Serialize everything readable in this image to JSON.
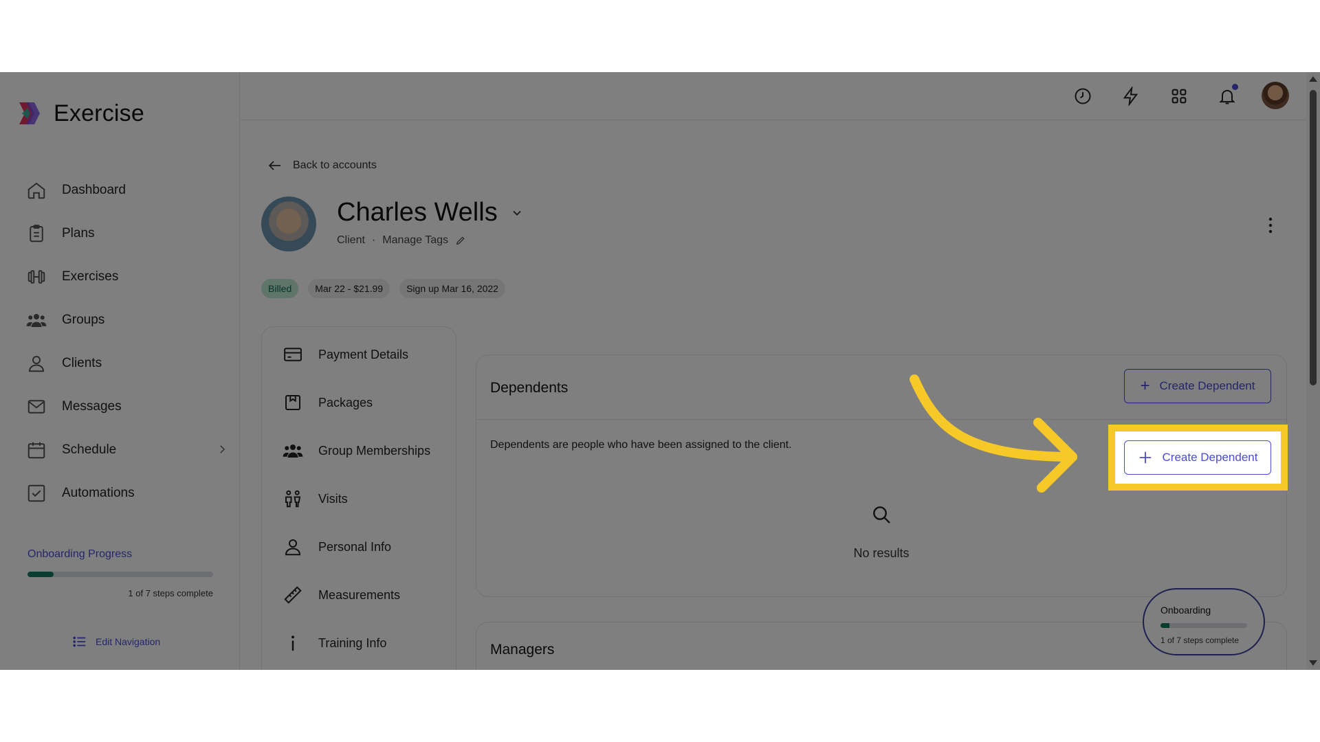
{
  "app": {
    "name": "Exercise",
    "brand_colors": [
      "#e0335f",
      "#7b4de0",
      "#2bb5a0"
    ]
  },
  "sidebar": {
    "items": [
      {
        "label": "Dashboard",
        "icon": "home-icon"
      },
      {
        "label": "Plans",
        "icon": "clipboard-icon"
      },
      {
        "label": "Exercises",
        "icon": "dumbbell-icon"
      },
      {
        "label": "Groups",
        "icon": "users-icon"
      },
      {
        "label": "Clients",
        "icon": "user-icon"
      },
      {
        "label": "Messages",
        "icon": "mail-icon"
      },
      {
        "label": "Schedule",
        "icon": "calendar-icon"
      },
      {
        "label": "Automations",
        "icon": "checkbox-icon"
      }
    ],
    "onboarding": {
      "title": "Onboarding Progress",
      "steps": "1 of 7 steps complete",
      "progress": 0.14
    },
    "edit_navigation": "Edit Navigation"
  },
  "topbar": {
    "icons": [
      "clock-icon",
      "bolt-icon",
      "grid-icon",
      "bell-icon",
      "avatar"
    ]
  },
  "main": {
    "back_label": "Back to accounts",
    "client": {
      "name": "Charles Wells",
      "role": "Client",
      "manage_tags": "Manage Tags"
    },
    "tags": [
      "Billed",
      "Mar 22 - $21.99",
      "Sign up Mar 16, 2022"
    ],
    "subnav": [
      {
        "label": "Payment Details",
        "icon": "credit-card-icon"
      },
      {
        "label": "Packages",
        "icon": "package-icon"
      },
      {
        "label": "Group Memberships",
        "icon": "group-icon"
      },
      {
        "label": "Visits",
        "icon": "visits-icon"
      },
      {
        "label": "Personal Info",
        "icon": "person-icon"
      },
      {
        "label": "Measurements",
        "icon": "ruler-icon"
      },
      {
        "label": "Training Info",
        "icon": "info-icon"
      }
    ],
    "dependents": {
      "title": "Dependents",
      "description": "Dependents are people who have been assigned to the client.",
      "empty": "No results",
      "create_label": "Create Dependent"
    },
    "managers": {
      "title": "Managers"
    }
  },
  "onboarding_widget": {
    "title": "Onboarding",
    "steps": "1 of 7 steps complete",
    "progress": 0.1
  },
  "colors": {
    "accent": "#4a4bd8",
    "highlight": "#f6c928",
    "progress": "#127a5b"
  }
}
